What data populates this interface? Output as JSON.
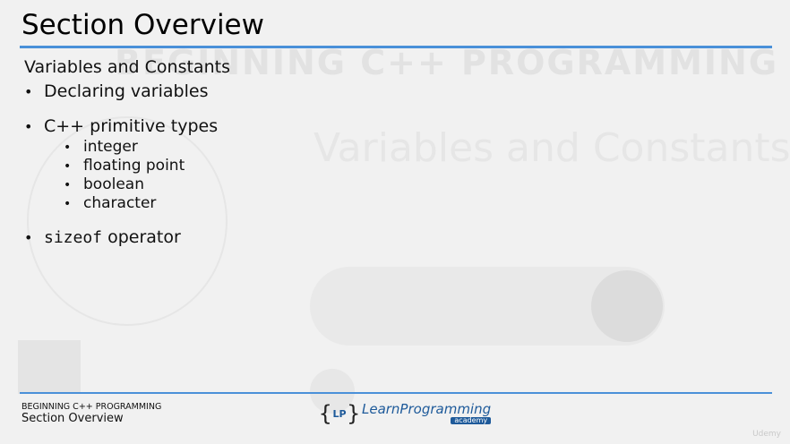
{
  "slide": {
    "title": "Section Overview",
    "subtitle": "Variables and Constants",
    "bullets": [
      {
        "text": "Declaring variables"
      },
      {
        "text": "C++ primitive types",
        "children": [
          "integer",
          "floating point",
          "boolean",
          "character"
        ]
      },
      {
        "code": "sizeof",
        "text": " operator"
      }
    ]
  },
  "background": {
    "course_title": "BEGINNING C++ PROGRAMMING",
    "section_title": "Variables and Constants"
  },
  "footer": {
    "course": "BEGINNING C++ PROGRAMMING",
    "section": "Section Overview",
    "logo_brand": "LearnProgramming",
    "logo_badge": "LP",
    "logo_sub": "academy",
    "watermark": "Udemy"
  },
  "colors": {
    "accent_rule": "#4a90d9",
    "logo_blue": "#1e5a9a"
  }
}
